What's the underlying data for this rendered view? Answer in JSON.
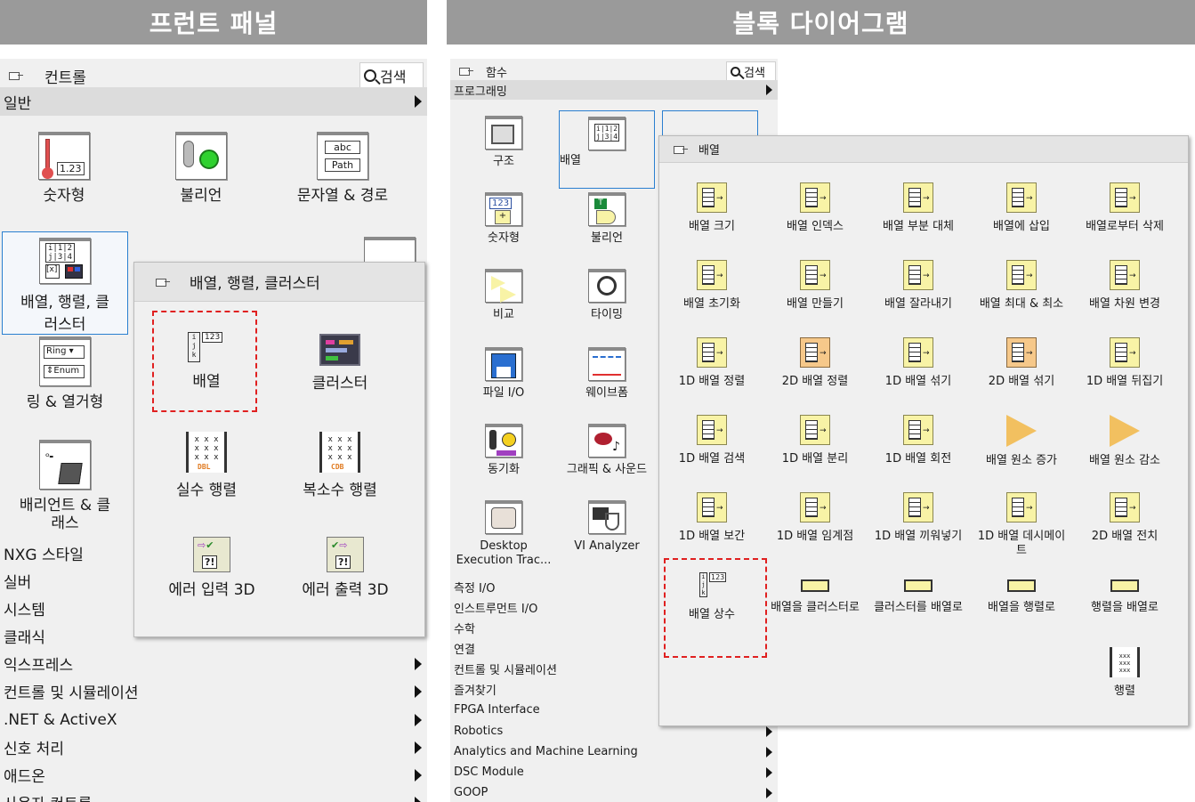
{
  "left": {
    "banner": "프런트 패널",
    "header": {
      "title": "컨트롤",
      "search": "검색"
    },
    "top_category": "일반",
    "palette_items": [
      "숫자형",
      "불리언",
      "문자열 & 경로",
      "배열, 행렬, 클러스터",
      "링 & 열거형",
      "배리언트 & 클래스"
    ],
    "icon_text": {
      "numeric": "1.23",
      "str1": "abc",
      "str2": "Path",
      "ring": "Ring",
      "enum": "Enum",
      "array": "i 1 2\nj 3 4"
    },
    "categories": [
      "NXG 스타일",
      "실버",
      "시스템",
      "클래식",
      "익스프레스",
      "컨트롤 및 시뮬레이션",
      ".NET & ActiveX",
      "신호 처리",
      "애드온",
      "사용자 컨트롤"
    ],
    "popup": {
      "title": "배열, 행렬, 클러스터",
      "items": [
        "배열",
        "클러스터",
        "실수 행렬",
        "복소수 행렬",
        "에러 입력 3D",
        "에러 출력 3D"
      ],
      "icon_text": {
        "array": "123",
        "real": "DBL",
        "complex": "CDB",
        "err": "?!"
      }
    }
  },
  "right": {
    "banner": "블록 다이어그램",
    "header": {
      "title": "함수",
      "search": "검색"
    },
    "top_category": "프로그래밍",
    "palette_items": [
      "구조",
      "배열",
      "숫자형",
      "불리언",
      "비교",
      "타이밍",
      "파일 I/O",
      "웨이브폼",
      "동기화",
      "그래픽 & 사운드",
      "Desktop Execution Trac...",
      "VI Analyzer"
    ],
    "icon_text": {
      "numeric": "123",
      "bool": "T"
    },
    "categories": [
      "측정 I/O",
      "인스트루먼트 I/O",
      "수학",
      "연결",
      "컨트롤 및 시뮬레이션",
      "즐겨찾기",
      "FPGA Interface",
      "Robotics",
      "Analytics and Machine Learning",
      "DSC Module",
      "GOOP"
    ],
    "popup": {
      "title": "배열",
      "items": [
        "배열 크기",
        "배열 인덱스",
        "배열 부분 대체",
        "배열에 삽입",
        "배열로부터 삭제",
        "배열 초기화",
        "배열 만들기",
        "배열 잘라내기",
        "배열 최대 & 최소",
        "배열 차원 변경",
        "1D 배열 정렬",
        "2D 배열 정렬",
        "1D 배열 섞기",
        "2D 배열 섞기",
        "1D 배열 뒤집기",
        "1D 배열 검색",
        "1D 배열 분리",
        "1D 배열 회전",
        "배열 원소 증가",
        "배열 원소 감소",
        "1D 배열 보간",
        "1D 배열 임계점",
        "1D 배열 끼워넣기",
        "1D 배열 데시메이트",
        "2D 배열 전치",
        "배열 상수",
        "배열을 클러스터로",
        "클러스터를 배열로",
        "배열을 행렬로",
        "행렬을 배열로",
        "행렬"
      ],
      "icon_text": {
        "const": "123"
      }
    }
  },
  "colors": {
    "banner": "#9a9a9a",
    "panel": "#f0f0f0",
    "highlight": "#e02020",
    "selection": "#2a7fd0",
    "icon_yellow": "#f8f3a6",
    "icon_orange": "#f6c88a"
  }
}
